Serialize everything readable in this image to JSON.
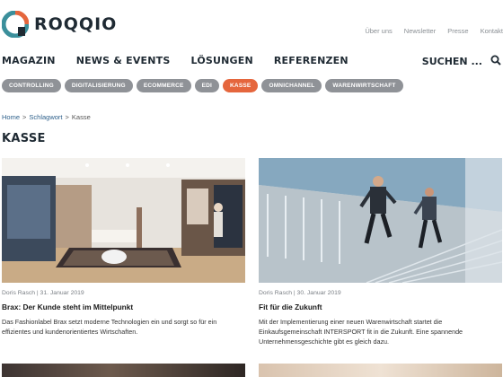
{
  "brand": {
    "logo_text": "ROQQIO"
  },
  "util_nav": [
    "Über uns",
    "Newsletter",
    "Presse",
    "Kontakt"
  ],
  "main_nav": [
    "MAGAZIN",
    "NEWS & EVENTS",
    "LÖSUNGEN",
    "REFERENZEN"
  ],
  "search": {
    "label": "SUCHEN ..."
  },
  "tags": [
    {
      "label": "CONTROLLING",
      "active": false
    },
    {
      "label": "DIGITALISIERUNG",
      "active": false
    },
    {
      "label": "ECOMMERCE",
      "active": false
    },
    {
      "label": "EDI",
      "active": false
    },
    {
      "label": "KASSE",
      "active": true
    },
    {
      "label": "OMNICHANNEL",
      "active": false
    },
    {
      "label": "WARENWIRTSCHAFT",
      "active": false
    }
  ],
  "breadcrumb": {
    "home": "Home",
    "sep": ">",
    "parent": "Schlagwort",
    "current": "Kasse"
  },
  "page_title": "KASSE",
  "articles": [
    {
      "meta": "Doris Rasch | 31. Januar 2019",
      "title": "Brax: Der Kunde steht im Mittelpunkt",
      "excerpt": "Das Fashionlabel Brax setzt moderne Technologien ein und sorgt so für ein effizientes und kundenorientiertes Wirtschaften."
    },
    {
      "meta": "Doris Rasch | 30. Januar 2019",
      "title": "Fit für die Zukunft",
      "excerpt": "Mit der Implementierung einer neuen Warenwirtschaft startet die Einkaufsgemeinschaft INTERSPORT fit in die Zukunft. Eine spannende Unternehmensgeschichte gibt es gleich dazu."
    }
  ],
  "colors": {
    "accent": "#e5663d",
    "tag": "#8f9297",
    "logo_teal": "#3b8f9b",
    "dark": "#1f2a33"
  },
  "icons": {
    "logo": "roqqio-q-logo",
    "search": "search-icon"
  }
}
